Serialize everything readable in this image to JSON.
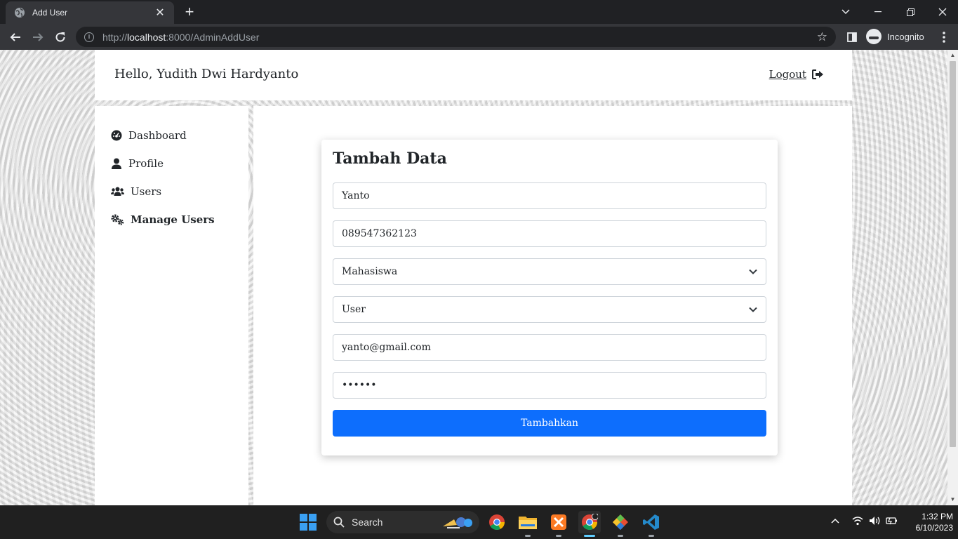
{
  "browser": {
    "tab_title": "Add User",
    "url_prefix": "http://",
    "url_host": "localhost",
    "url_path": ":8000/AdminAddUser",
    "profile_label": "Incognito"
  },
  "header": {
    "greeting": "Hello, Yudith Dwi Hardyanto",
    "logout_label": "Logout"
  },
  "sidebar": {
    "items": [
      {
        "label": "Dashboard",
        "icon": "dashboard-icon"
      },
      {
        "label": "Profile",
        "icon": "user-icon"
      },
      {
        "label": "Users",
        "icon": "users-icon"
      },
      {
        "label": "Manage Users",
        "icon": "cogs-icon",
        "active": true
      }
    ]
  },
  "form": {
    "title": "Tambah Data",
    "name_value": "Yanto",
    "phone_value": "089547362123",
    "status_selected": "Mahasiswa",
    "role_selected": "User",
    "email_value": "yanto@gmail.com",
    "password_masked": "••••••",
    "submit_label": "Tambahkan"
  },
  "taskbar": {
    "search_label": "Search",
    "time": "1:32 PM",
    "date": "6/10/2023"
  },
  "colors": {
    "primary": "#0d6efd",
    "chrome_dark": "#202124",
    "chrome_toolbar": "#35363a"
  }
}
